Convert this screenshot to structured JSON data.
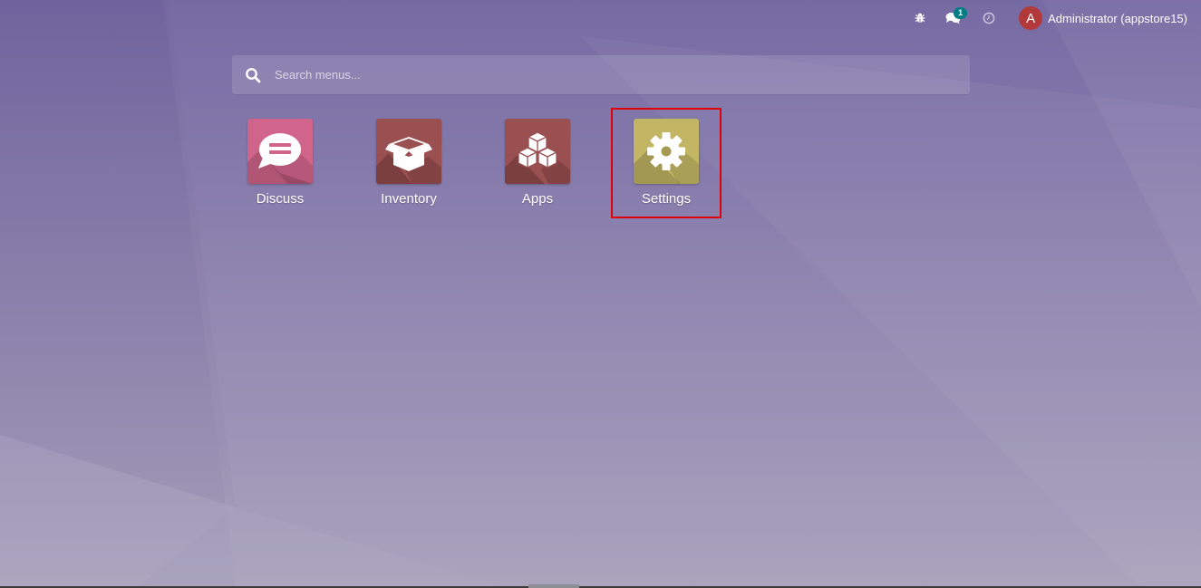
{
  "systray": {
    "debug_icon": "bug-icon",
    "messages_icon": "comments-icon",
    "messages_count": "1",
    "activity_icon": "clock-icon",
    "user": {
      "avatar_letter": "A",
      "name": "Administrator (appstore15)",
      "avatar_color": "#b3383a"
    },
    "badge_color": "#017e84"
  },
  "search": {
    "placeholder": "Search menus...",
    "value": ""
  },
  "apps": [
    {
      "label": "Discuss",
      "icon": "chat-bubble-icon",
      "color": "#d1648a",
      "selected": false
    },
    {
      "label": "Inventory",
      "icon": "open-box-icon",
      "color": "#9a4f51",
      "selected": false
    },
    {
      "label": "Apps",
      "icon": "cubes-icon",
      "color": "#9a4f51",
      "selected": false
    },
    {
      "label": "Settings",
      "icon": "gear-icon",
      "color": "#c2b664",
      "selected": true
    }
  ],
  "highlight_color": "#e0000c"
}
